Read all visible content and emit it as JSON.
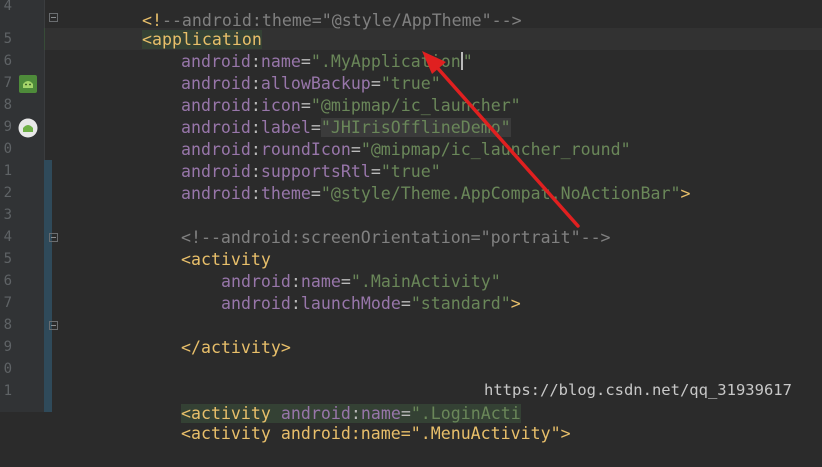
{
  "gutter": {
    "line_numbers": [
      "4",
      "5",
      "6",
      "7",
      "8",
      "9",
      "0",
      "1",
      "2",
      "3",
      "4",
      "5",
      "6",
      "7",
      "8",
      "9",
      "0",
      "1"
    ]
  },
  "code": {
    "line_01": {
      "prefix": "<!",
      "rest": "--android:theme=\"@style/AppTheme\"-->"
    },
    "line_02": {
      "bracket": "<",
      "tag": "application"
    },
    "line_03": {
      "ns": "android",
      "colon": ":",
      "attr": "name",
      "eq": "=",
      "value": "\".MyApplication",
      "close_quote": "\""
    },
    "line_04": {
      "ns": "android",
      "colon": ":",
      "attr": "allowBackup",
      "eq": "=",
      "value": "\"true\""
    },
    "line_05": {
      "ns": "android",
      "colon": ":",
      "attr": "icon",
      "eq": "=",
      "value": "\"@mipmap/ic_launcher\""
    },
    "line_06": {
      "ns": "android",
      "colon": ":",
      "attr": "label",
      "eq": "=",
      "value": "\"JHIrisOfflineDemo\""
    },
    "line_07": {
      "ns": "android",
      "colon": ":",
      "attr": "roundIcon",
      "eq": "=",
      "value": "\"@mipmap/ic_launcher_round\""
    },
    "line_08": {
      "ns": "android",
      "colon": ":",
      "attr": "supportsRtl",
      "eq": "=",
      "value": "\"true\""
    },
    "line_09": {
      "ns": "android",
      "colon": ":",
      "attr": "theme",
      "eq": "=",
      "value": "\"@style/Theme.AppCompat.NoActionBar\"",
      "end": ">"
    },
    "line_11": {
      "comment": "<!--android:screenOrientation=\"portrait\"-->"
    },
    "line_12": {
      "bracket": "<",
      "tag": "activity"
    },
    "line_13": {
      "ns": "android",
      "colon": ":",
      "attr": "name",
      "eq": "=",
      "value": "\".MainActivity\""
    },
    "line_14": {
      "ns": "android",
      "colon": ":",
      "attr": "launchMode",
      "eq": "=",
      "value": "\"standard\"",
      "end": ">"
    },
    "line_16": {
      "text": "</activity>"
    },
    "line_19": {
      "bracket": "<",
      "tag": "activity",
      "ns": "android",
      "colon": ":",
      "attr": "name",
      "eq": "=",
      "value": "\".LoginActi"
    },
    "line_20": {
      "text": "<activity android:name=\".MenuActivity\">"
    }
  },
  "watermark": "https://blog.csdn.net/qq_31939617",
  "colors": {
    "background": "#2b2b2b",
    "tag": "#e8bf6a",
    "namespace": "#9876aa",
    "string": "#6a8759",
    "comment": "#808080",
    "arrow": "#e02020"
  }
}
